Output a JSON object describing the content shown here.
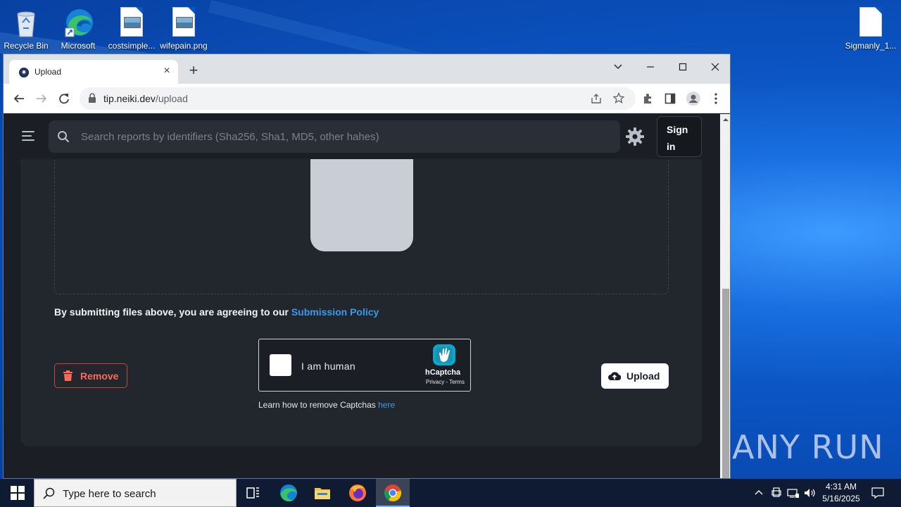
{
  "desktop": {
    "icons": [
      {
        "label": "Recycle Bin"
      },
      {
        "label": "Microsoft"
      },
      {
        "label": "costsimple..."
      },
      {
        "label": "wifepain.png"
      },
      {
        "label": "Sigmanly_1..."
      }
    ],
    "watermark": "ANY RUN"
  },
  "browser": {
    "tab": {
      "title": "Upload",
      "close": "×"
    },
    "new_tab": "+",
    "url": {
      "host": "tip.neiki.dev",
      "path": "/upload"
    }
  },
  "page": {
    "search": {
      "placeholder": "Search reports by identifiers (Sha256, Sha1, MD5, other hahes)"
    },
    "signin_line1": "Sign",
    "signin_line2": "in",
    "agree_text": "By submitting files above, you are agreeing to our ",
    "agree_link": "Submission Policy",
    "remove_label": "Remove",
    "upload_label": "Upload",
    "captcha": {
      "checkbox_label": "I am human",
      "brand": "hCaptcha",
      "terms": "Privacy - Terms"
    },
    "learn_text": "Learn how to remove Captchas ",
    "learn_link": "here"
  },
  "taskbar": {
    "search_placeholder": "Type here to search",
    "time": "4:31 AM",
    "date": "5/16/2025"
  },
  "colors": {
    "page_bg": "#1b1e24",
    "card_bg": "#22262d",
    "link": "#3b9af0",
    "danger": "#ff6a55"
  }
}
